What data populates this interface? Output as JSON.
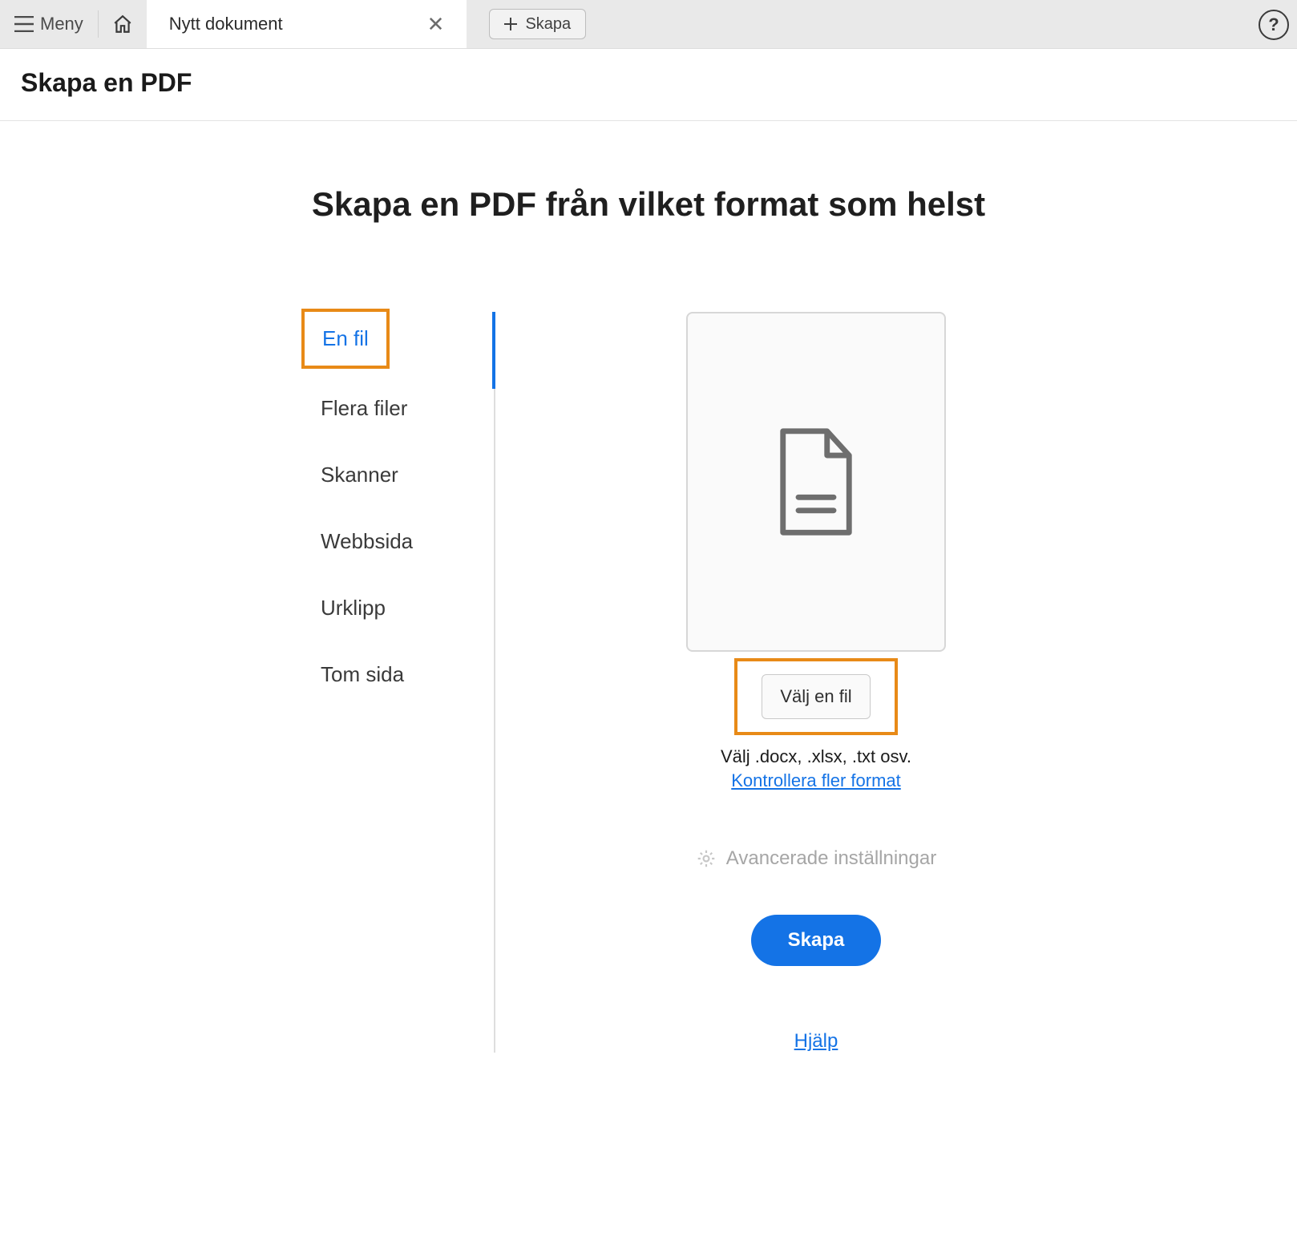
{
  "toolbar": {
    "menu_label": "Meny",
    "active_tab_title": "Nytt dokument",
    "create_tab_label": "Skapa"
  },
  "page": {
    "title": "Skapa en PDF",
    "heading": "Skapa en PDF från vilket format som helst"
  },
  "options": [
    {
      "label": "En fil",
      "active": true
    },
    {
      "label": "Flera filer"
    },
    {
      "label": "Skanner"
    },
    {
      "label": "Webbsida"
    },
    {
      "label": "Urklipp"
    },
    {
      "label": "Tom sida"
    }
  ],
  "detail": {
    "choose_file": "Välj en fil",
    "hint": "Välj .docx, .xlsx, .txt osv.",
    "more_formats": "Kontrollera fler format",
    "advanced": "Avancerade inställningar",
    "create_btn": "Skapa",
    "help": "Hjälp"
  },
  "colors": {
    "accent": "#1473e6",
    "highlight_border": "#e88a17"
  }
}
